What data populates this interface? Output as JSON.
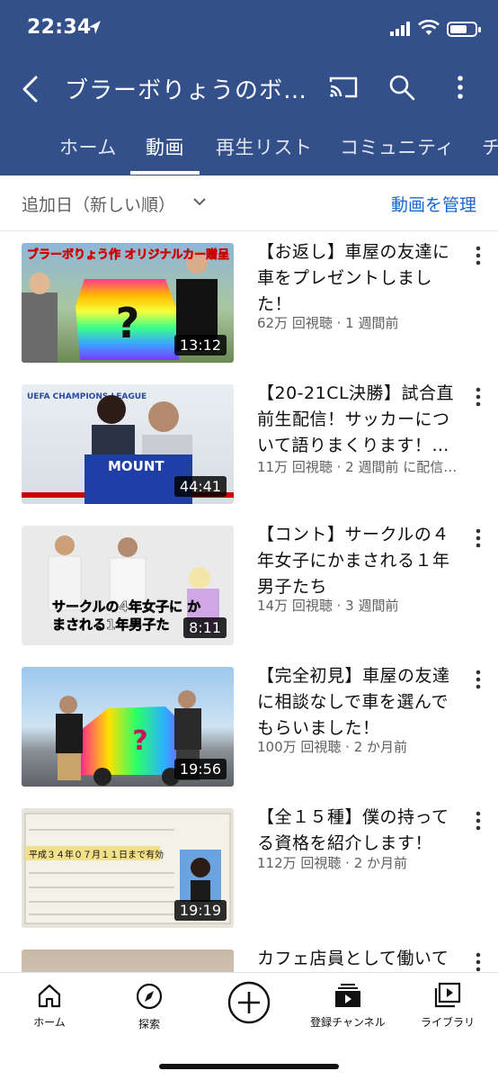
{
  "status_bar": {
    "time": "22:34"
  },
  "header": {
    "title": "ブラーボりょうのボ…",
    "bg_color": "#33508a"
  },
  "tabs": [
    {
      "label": "ホーム"
    },
    {
      "label": "動画"
    },
    {
      "label": "再生リスト"
    },
    {
      "label": "コミュニティ"
    },
    {
      "label": "チ"
    }
  ],
  "sort": {
    "label": "追加日（新しい順）",
    "manage_label": "動画を管理"
  },
  "videos": [
    {
      "title": "【お返し】車屋の友達に車をプレゼントしました！",
      "meta": "62万 回視聴 · 1 週間前",
      "duration": "13:12",
      "thumb_text": "ブラーボりょう作 オリジナルカー贈呈"
    },
    {
      "title": "【20-21CL決勝】試合直前生配信！サッカーについて語りまくります！…",
      "meta": "11万 回視聴 · 2 週間前 に配信…",
      "duration": "44:41",
      "thumb_text": "MOUNT"
    },
    {
      "title": "【コント】サークルの４年女子にかまされる１年男子たち",
      "meta": "14万 回視聴 · 3 週間前",
      "duration": "8:11",
      "thumb_text": "サークルの4年女子に かまされる1年男子た"
    },
    {
      "title": "【完全初見】車屋の友達に相談なしで車を選んでもらいました！",
      "meta": "100万 回視聴 · 2 か月前",
      "duration": "19:56",
      "thumb_text": "?"
    },
    {
      "title": "【全１５種】僕の持ってる資格を紹介します！",
      "meta": "112万 回視聴 · 2 か月前",
      "duration": "19:19",
      "thumb_text": "平成３４年０７月１１日まで有効"
    },
    {
      "title": "カフェ店員として働いて",
      "meta": "",
      "duration": "",
      "thumb_text": ""
    }
  ],
  "bottom_nav": [
    {
      "label": "ホーム",
      "icon": "home-icon"
    },
    {
      "label": "探索",
      "icon": "explore-icon"
    },
    {
      "label": "",
      "icon": "create-icon"
    },
    {
      "label": "登録チャンネル",
      "icon": "subscriptions-icon"
    },
    {
      "label": "ライブラリ",
      "icon": "library-icon"
    }
  ]
}
